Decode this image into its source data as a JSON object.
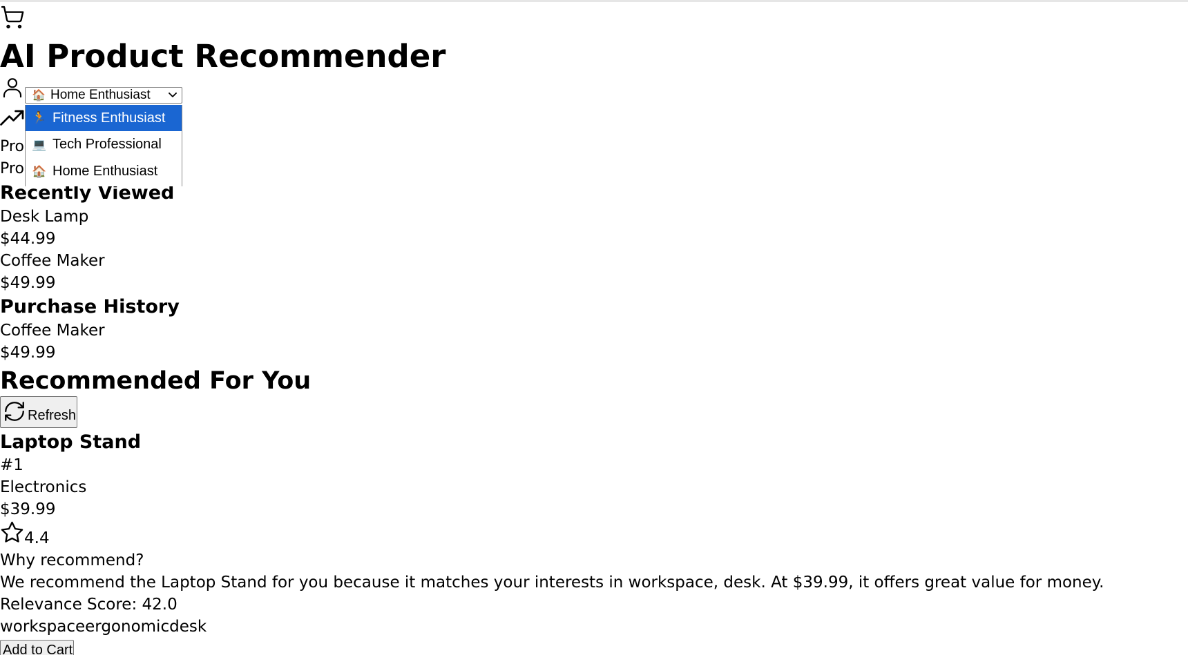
{
  "app": {
    "title": "AI Product Recommender",
    "cart_icon": "shopping-cart-icon"
  },
  "profile": {
    "user_icon": "user-icon",
    "trend_icon": "trending-up-icon",
    "select": {
      "selected_emoji": "🏠",
      "selected_label": "Home Enthusiast",
      "options": [
        {
          "emoji": "🏃",
          "label": "Fitness Enthusiast",
          "highlighted": true
        },
        {
          "emoji": "💻",
          "label": "Tech Professional",
          "highlighted": false
        },
        {
          "emoji": "🏠",
          "label": "Home Enthusiast",
          "highlighted": false
        }
      ]
    },
    "line1": "Pro",
    "line2": "Pro"
  },
  "recently_viewed": {
    "heading": "Recently Viewed",
    "items": [
      {
        "name": "Desk Lamp",
        "price": "$44.99"
      },
      {
        "name": "Coffee Maker",
        "price": "$49.99"
      }
    ]
  },
  "purchase_history": {
    "heading": "Purchase History",
    "items": [
      {
        "name": "Coffee Maker",
        "price": "$49.99"
      }
    ]
  },
  "recommendations": {
    "heading": "Recommended For You",
    "refresh_label": "Refresh",
    "items": [
      {
        "name": "Laptop Stand",
        "rank": "#1",
        "category": "Electronics",
        "price": "$39.99",
        "rating": "4.4",
        "why_label": "Why recommend?",
        "explanation": "We recommend the Laptop Stand for you because it matches your interests in workspace, desk. At $39.99, it offers great value for money.",
        "relevance": "Relevance Score: 42.0",
        "tags": "workspaceergonomicdesk",
        "add_label": "Add to Cart"
      }
    ]
  },
  "colors": {
    "highlight": "#1a66d2",
    "button_bg": "#efefef",
    "button_border": "#767676"
  }
}
